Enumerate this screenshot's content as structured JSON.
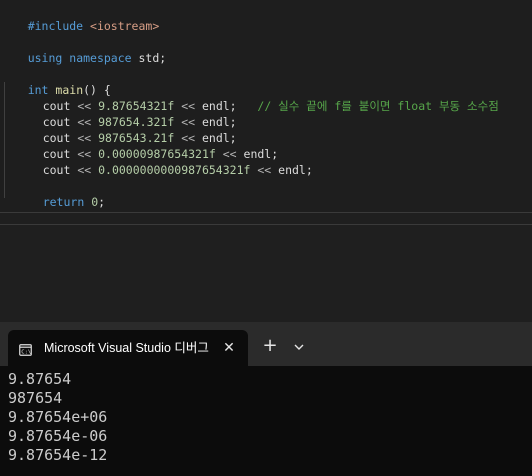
{
  "editor": {
    "lines": {
      "include": {
        "directive": "#include ",
        "header": "<iostream>"
      },
      "using": {
        "kw1": "using",
        "kw2": "namespace",
        "rest": " std;"
      },
      "main": {
        "type": "int",
        "name": "main",
        "rest": "() {"
      },
      "cout1": {
        "stmt": "cout",
        "op1": " << ",
        "num": "9.87654321f",
        "op2": " << ",
        "endl": "endl;",
        "comment": "// 실수 끝에 f를 붙이면 float 부동 소수점"
      },
      "cout2": {
        "stmt": "cout",
        "op1": " << ",
        "num": "987654.321f",
        "op2": " << ",
        "endl": "endl;"
      },
      "cout3": {
        "stmt": "cout",
        "op1": " << ",
        "num": "9876543.21f",
        "op2": " << ",
        "endl": "endl;"
      },
      "cout4": {
        "stmt": "cout",
        "op1": " << ",
        "num": "0.00000987654321f",
        "op2": " << ",
        "endl": "endl;"
      },
      "cout5": {
        "stmt": "cout",
        "op1": " << ",
        "num": "0.0000000000987654321f",
        "op2": " << ",
        "endl": "endl;"
      },
      "ret": {
        "kw": "return",
        "num": "0",
        "rest": ";"
      },
      "close": "}"
    },
    "colors": {
      "keyword": "#569cd6",
      "string": "#d69d85",
      "number": "#b5cea8",
      "comment": "#57a64a"
    }
  },
  "terminal": {
    "tab_title": "Microsoft Visual Studio 디버그",
    "tab_icon": "console-icon",
    "close_icon": "close-icon",
    "new_tab_icon": "plus-icon",
    "dropdown_icon": "chevron-down-icon",
    "output": [
      "9.87654",
      "987654",
      "9.87654e+06",
      "9.87654e-06",
      "9.87654e-12"
    ]
  }
}
